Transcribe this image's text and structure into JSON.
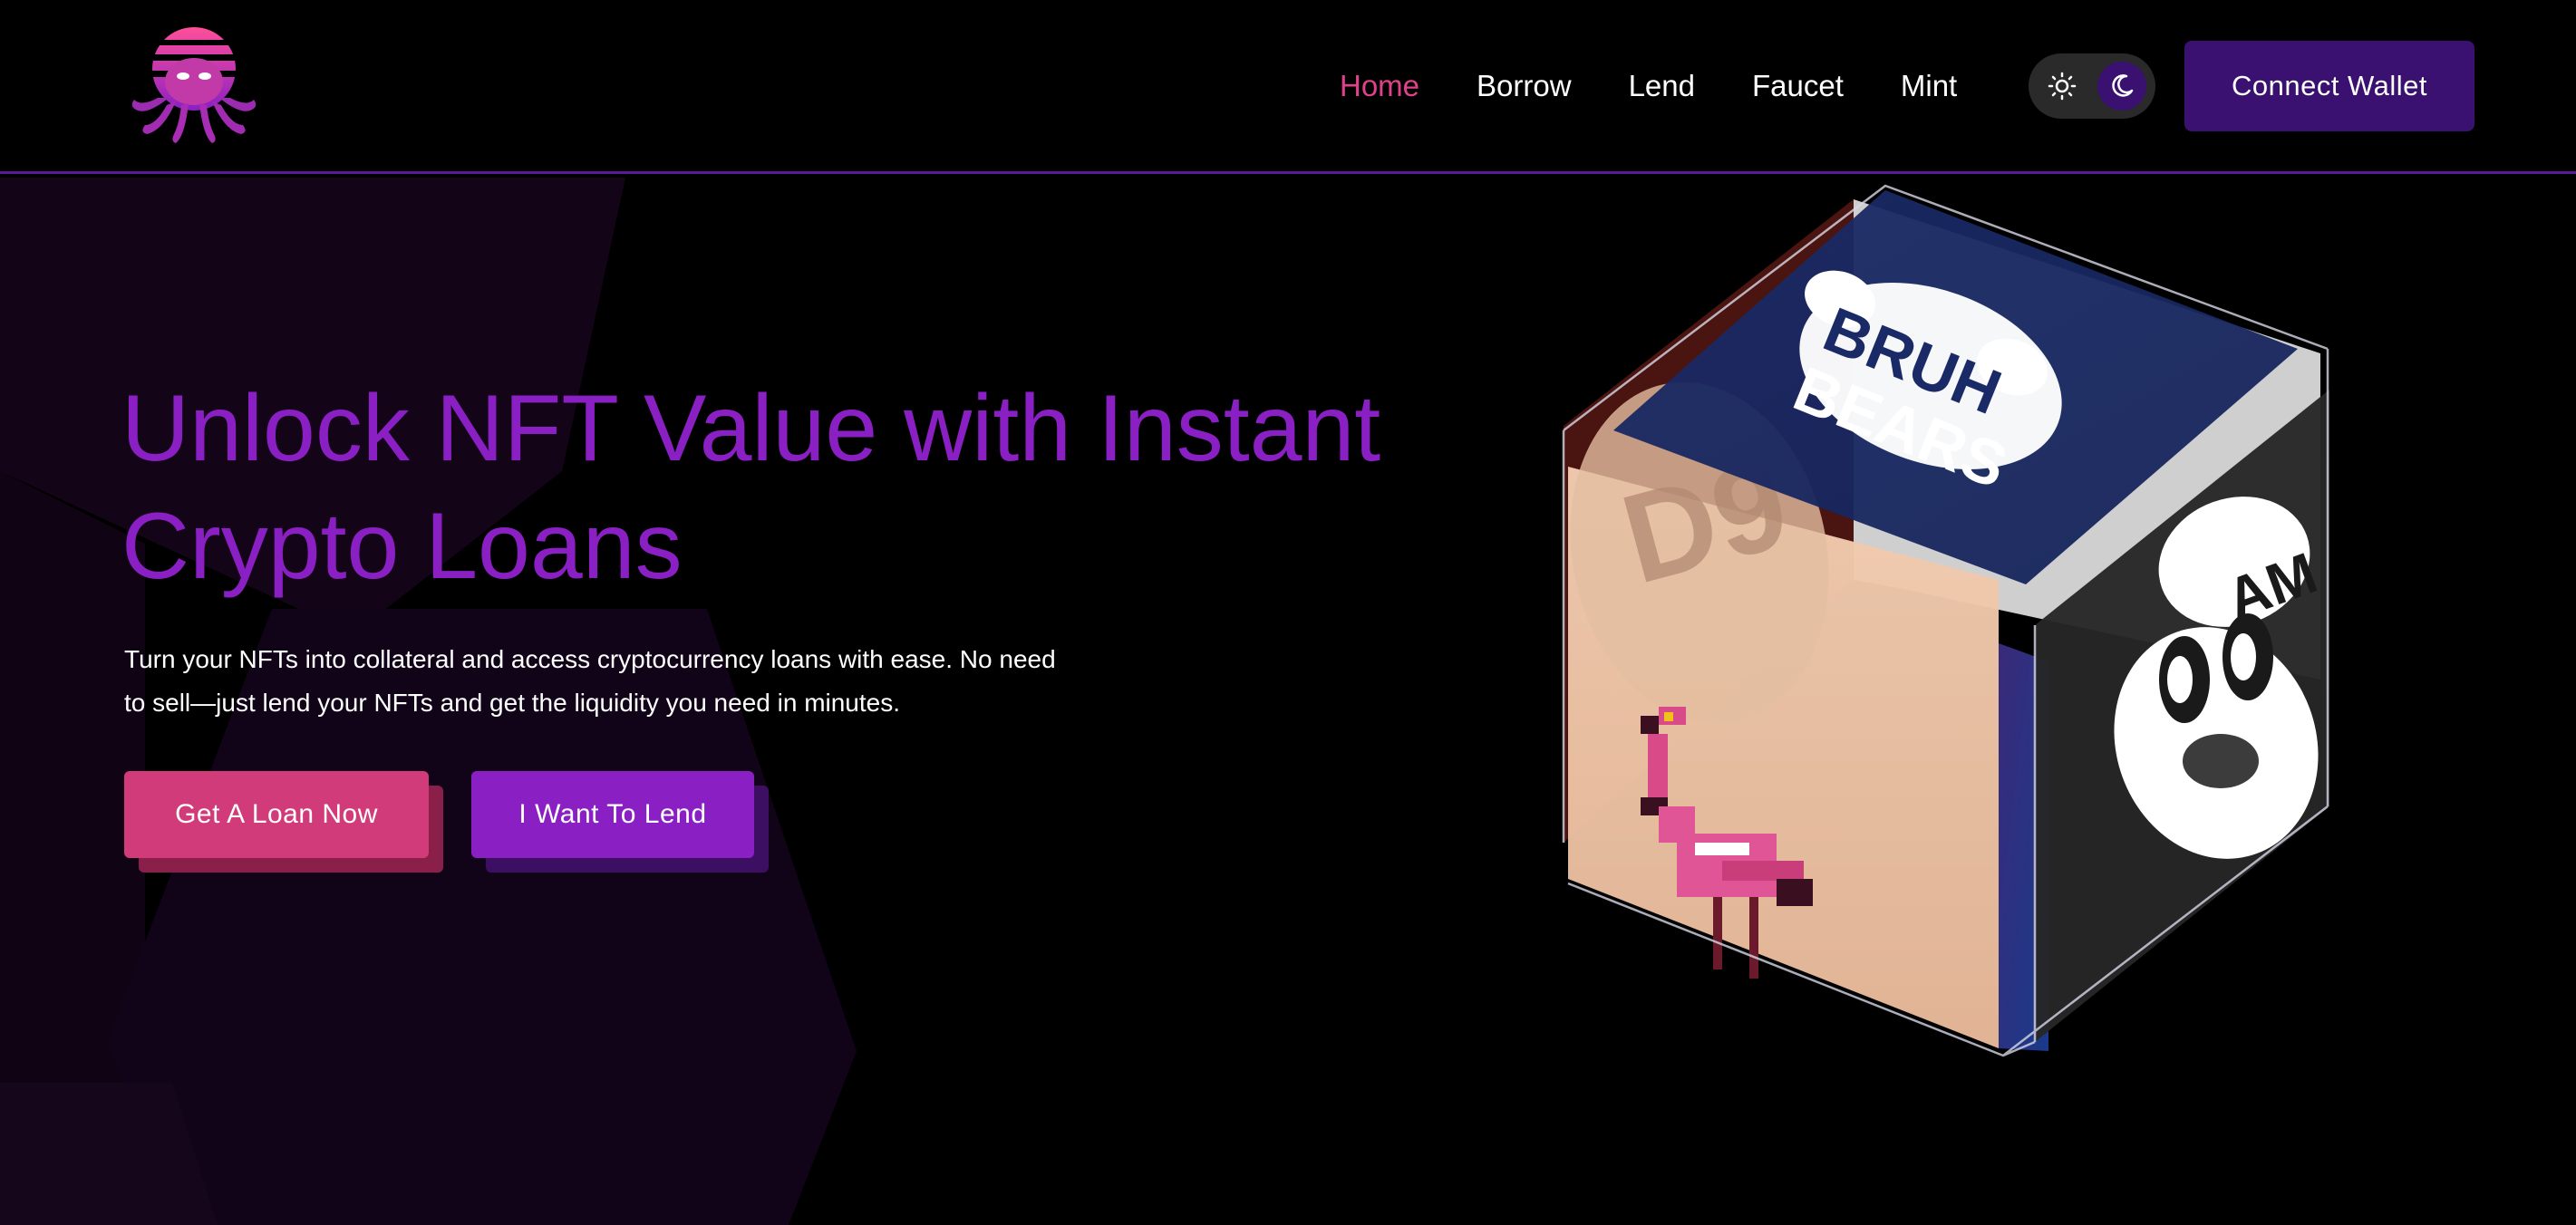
{
  "brand": {
    "logo_icon": "octopus-logo-icon",
    "accent_pink": "#e0418b",
    "accent_purple": "#8a1fc4",
    "dark_purple": "#3a1070"
  },
  "nav": {
    "items": [
      {
        "label": "Home",
        "active": true
      },
      {
        "label": "Borrow",
        "active": false
      },
      {
        "label": "Lend",
        "active": false
      },
      {
        "label": "Faucet",
        "active": false
      },
      {
        "label": "Mint",
        "active": false
      }
    ]
  },
  "theme_toggle": {
    "options": [
      "sun-icon",
      "moon-icon"
    ],
    "selected": "moon-icon"
  },
  "header": {
    "connect_label": "Connect Wallet"
  },
  "hero": {
    "title_line1": "Unlock NFT Value with Instant",
    "title_line2": "Crypto Loans",
    "subtitle_line1": "Turn your NFTs into collateral and access cryptocurrency loans with ease. No need",
    "subtitle_line2": "to sell—just lend your NFTs and get the liquidity you need in minutes.",
    "primary_cta": "Get A Loan Now",
    "secondary_cta": "I Want To Lend"
  },
  "cube_art": {
    "top_face_text_1": "BRUH",
    "top_face_text_2": "BEARS",
    "right_face_text": "AM",
    "left_face_text": "D9"
  }
}
